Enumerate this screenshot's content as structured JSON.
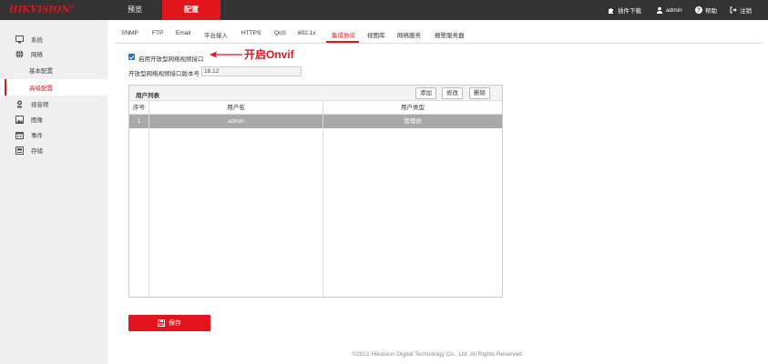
{
  "brand": {
    "logo": "HIKVISION",
    "logo_mark": "®",
    "accent": "#e0161c",
    "topbar_bg": "#333333"
  },
  "topnav": {
    "preview": "预览",
    "config": "配置"
  },
  "topbar_right": [
    {
      "icon": "puzzle-icon",
      "label": "插件下载"
    },
    {
      "icon": "user-icon",
      "label": "admin"
    },
    {
      "icon": "help-icon",
      "label": "帮助"
    },
    {
      "icon": "logout-icon",
      "label": "注销"
    }
  ],
  "sidebar": {
    "items": [
      {
        "icon": "monitor-icon",
        "label": "系统"
      },
      {
        "icon": "globe-icon",
        "label": "网络"
      },
      {
        "sub": true,
        "label": "基本配置"
      },
      {
        "sub": true,
        "label": "高级配置",
        "active": true
      },
      {
        "icon": "camera-icon",
        "label": "视音频"
      },
      {
        "icon": "image-icon",
        "label": "图像"
      },
      {
        "icon": "calendar-icon",
        "label": "事件"
      },
      {
        "icon": "storage-icon",
        "label": "存储"
      }
    ]
  },
  "subtabs": [
    "SNMP",
    "FTP",
    "Email",
    "平台接入",
    "HTTPS",
    "QoS",
    "802.1x",
    "集成协议",
    "视图库",
    "网络服务",
    "报警服务器"
  ],
  "active_subtab": "集成协议",
  "form": {
    "enable_onvif_label": "启用开放型网络视频接口",
    "enable_onvif_checked": true,
    "annotation": "开启Onvif",
    "version_label": "开放型网络视频接口版本号",
    "version_value": "18.12"
  },
  "user_table": {
    "title": "用户列表",
    "buttons": {
      "add": "添加",
      "modify": "修改",
      "delete": "删除"
    },
    "columns": [
      "序号",
      "用户名",
      "用户类型"
    ],
    "rows": [
      {
        "no": "1",
        "username": "admin",
        "type": "管理员"
      }
    ]
  },
  "save_label": "保存",
  "footer": "©2021 Hikvision Digital Technology Co., Ltd. All Rights Reserved."
}
